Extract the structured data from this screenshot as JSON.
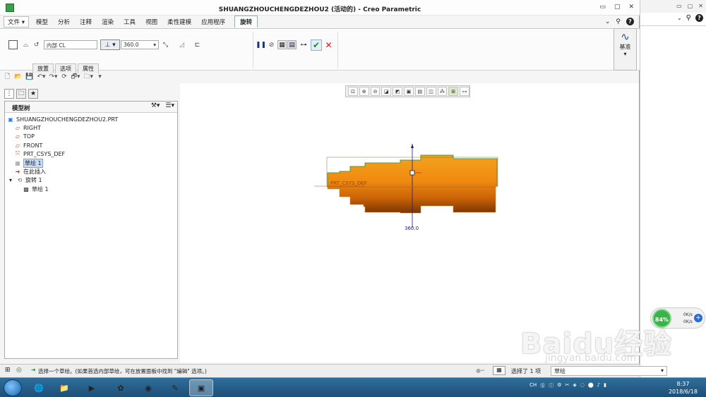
{
  "window": {
    "title": "SHUANGZHOUCHENGDEZHOU2 (活动的) - Creo Parametric",
    "controls": [
      "▭",
      "▢",
      "✕"
    ]
  },
  "menubar": {
    "file": "文件",
    "tabs": [
      "模型",
      "分析",
      "注释",
      "渲染",
      "工具",
      "视图",
      "柔性建模",
      "应用程序"
    ],
    "active_tab": "旋转"
  },
  "ribbon": {
    "side_field": "内部 CL",
    "angle_value": "360.0",
    "tabs": [
      "放置",
      "选项",
      "属性"
    ],
    "datum_label": "基准"
  },
  "model_tree": {
    "header": "模型树",
    "nodes": [
      {
        "label": "SHUANGZHOUCHENGDEZHOU2.PRT"
      },
      {
        "label": "RIGHT"
      },
      {
        "label": "TOP"
      },
      {
        "label": "FRONT"
      },
      {
        "label": "PRT_CSYS_DEF"
      },
      {
        "label": "草绘 1"
      },
      {
        "label": "在此插入"
      },
      {
        "label": "旋转 1"
      },
      {
        "label": "草绘 1"
      }
    ]
  },
  "graphics": {
    "csys_label": "PRT_CSYS_DEF",
    "dimension_label": "360.0"
  },
  "status": {
    "message": "选择一个草绘。(如果首选内部草绘，可在放置面板中找到 \"编辑\" 选项。)",
    "selection": "选择了 1 项",
    "filter": "草绘"
  },
  "taskbar": {
    "time": "8:37",
    "date": "2018/6/18",
    "lang": "CH"
  },
  "net_widget": {
    "percent": "84%",
    "up": "0K/s",
    "down": "0K/s"
  },
  "watermark": {
    "text": "Baidu经验",
    "url": "jingyan.baidu.com"
  }
}
